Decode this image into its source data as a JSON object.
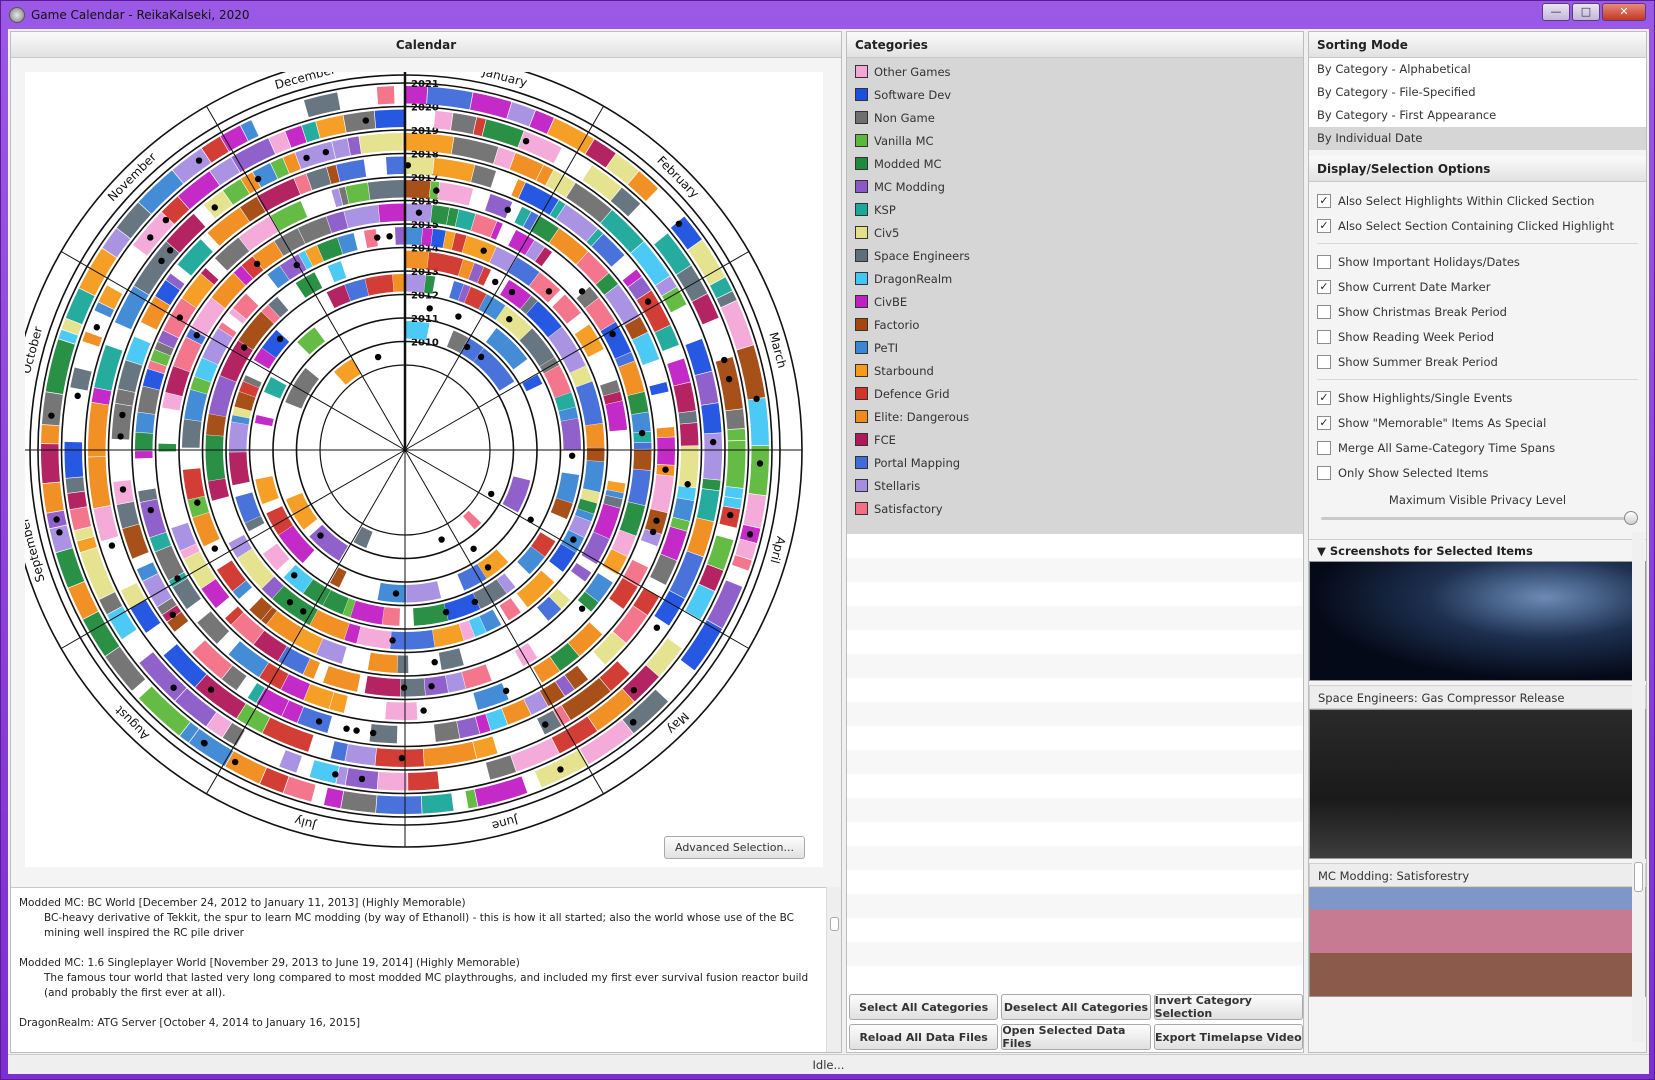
{
  "window": {
    "title": "Game Calendar - ReikaKalseki, 2020"
  },
  "calendar": {
    "header": "Calendar",
    "months": [
      "January",
      "February",
      "March",
      "April",
      "May",
      "June",
      "July",
      "August",
      "September",
      "October",
      "November",
      "December"
    ],
    "years": [
      "2010",
      "2011",
      "2012",
      "2013",
      "2014",
      "2015",
      "2016",
      "2017",
      "2018",
      "2019",
      "2020",
      "2021"
    ],
    "advanced_button": "Advanced Selection..."
  },
  "description": {
    "entries": [
      {
        "title": "Modded MC: BC World [December 24, 2012 to January 11, 2013] (Highly Memorable)",
        "body": "BC-heavy derivative of Tekkit, the spur to learn MC modding (by way of Ethanoll) - this is how it all started; also the world whose use of the BC mining well inspired the RC pile driver"
      },
      {
        "title": "Modded MC: 1.6 Singleplayer World [November 29, 2013 to June 19, 2014] (Highly Memorable)",
        "body": "The famous tour world that lasted very long compared to most modded MC playthroughs, and included my first ever survival fusion reactor build (and probably the first ever at all)."
      },
      {
        "title": "DragonRealm: ATG Server [October 4, 2014 to January 16, 2015]",
        "body": ""
      }
    ]
  },
  "categories": {
    "header": "Categories",
    "items": [
      {
        "label": "Other Games",
        "color": "#f4a6d7"
      },
      {
        "label": "Software Dev",
        "color": "#1a4fe0"
      },
      {
        "label": "Non Game",
        "color": "#6f6f6f"
      },
      {
        "label": "Vanilla MC",
        "color": "#5cb83a"
      },
      {
        "label": "Modded MC",
        "color": "#1e8a3c"
      },
      {
        "label": "MC Modding",
        "color": "#8a58c8"
      },
      {
        "label": "KSP",
        "color": "#1aa89a"
      },
      {
        "label": "Civ5",
        "color": "#e4e08a"
      },
      {
        "label": "Space Engineers",
        "color": "#5f6f7a"
      },
      {
        "label": "DragonRealm",
        "color": "#42c6f4"
      },
      {
        "label": "CivBE",
        "color": "#c01fc4"
      },
      {
        "label": "Factorio",
        "color": "#a3470e"
      },
      {
        "label": "PeTI",
        "color": "#3a86d4"
      },
      {
        "label": "Starbound",
        "color": "#f59a1a"
      },
      {
        "label": "Defence Grid",
        "color": "#d0342a"
      },
      {
        "label": "Elite: Dangerous",
        "color": "#f08a18"
      },
      {
        "label": "FCE",
        "color": "#b0185a"
      },
      {
        "label": "Portal Mapping",
        "color": "#3f6cd8"
      },
      {
        "label": "Stellaris",
        "color": "#a58de0"
      },
      {
        "label": "Satisfactory",
        "color": "#f26f86"
      }
    ],
    "buttons": [
      "Select All Categories",
      "Deselect All Categories",
      "Invert Category Selection",
      "Reload All Data Files",
      "Open Selected Data Files",
      "Export Timelapse Video"
    ]
  },
  "sorting": {
    "header": "Sorting Mode",
    "items": [
      "By Category - Alphabetical",
      "By Category - File-Specified",
      "By Category - First Appearance",
      "By Individual Date"
    ],
    "selected": "By Individual Date"
  },
  "options": {
    "header": "Display/Selection Options",
    "groups": [
      [
        {
          "label": "Also Select Highlights Within Clicked Section",
          "checked": true
        },
        {
          "label": "Also Select Section Containing Clicked Highlight",
          "checked": true
        }
      ],
      [
        {
          "label": "Show Important Holidays/Dates",
          "checked": false
        },
        {
          "label": "Show Current Date Marker",
          "checked": true
        },
        {
          "label": "Show Christmas Break Period",
          "checked": false
        },
        {
          "label": "Show Reading Week Period",
          "checked": false
        },
        {
          "label": "Show Summer Break Period",
          "checked": false
        }
      ],
      [
        {
          "label": "Show Highlights/Single Events",
          "checked": true
        },
        {
          "label": "Show \"Memorable\" Items As Special",
          "checked": true
        },
        {
          "label": "Merge All Same-Category Time Spans",
          "checked": false
        },
        {
          "label": "Only Show Selected Items",
          "checked": false
        }
      ]
    ],
    "slider_label": "Maximum Visible Privacy Level",
    "slider_value": 1.0
  },
  "screenshots": {
    "header": "Screenshots for Selected Items",
    "captions": [
      "Space Engineers: Gas Compressor Release",
      "MC Modding: Satisforestry"
    ]
  },
  "status": "Idle..."
}
